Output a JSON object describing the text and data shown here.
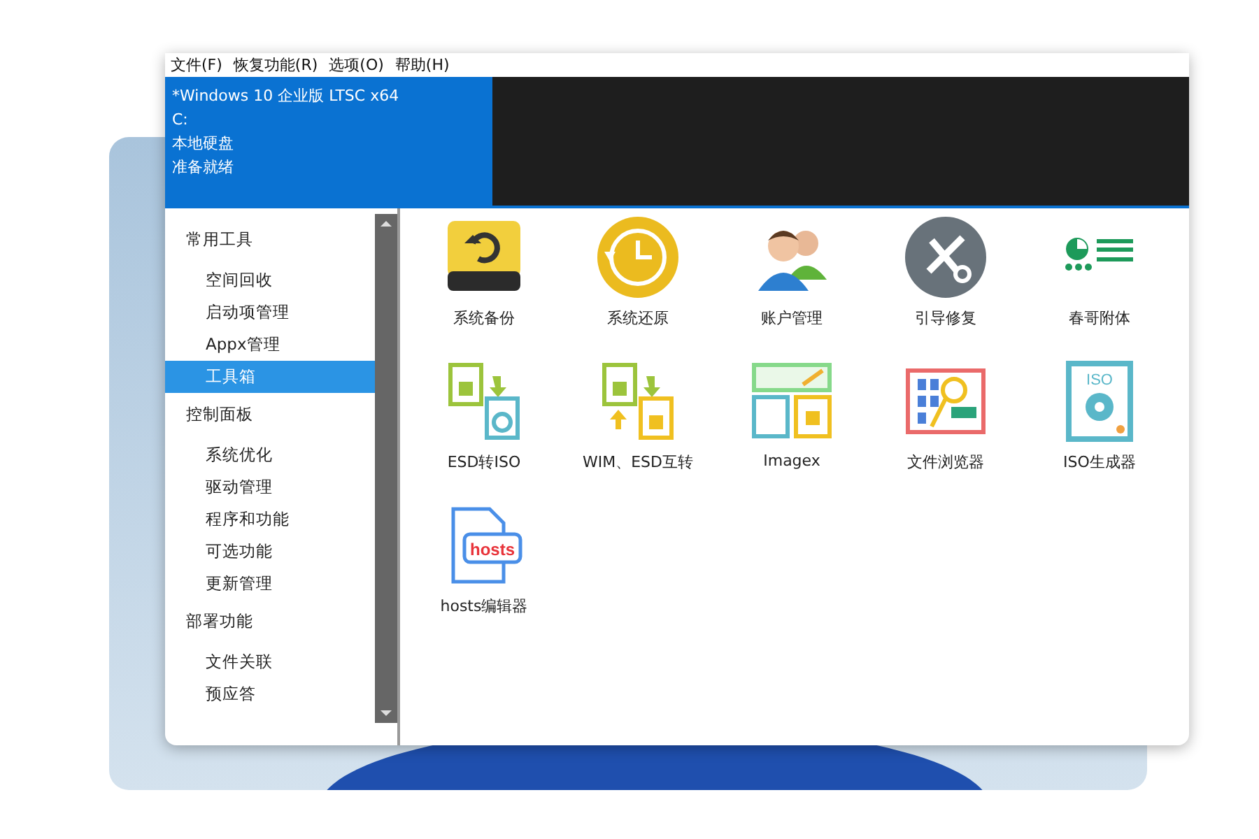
{
  "menu_bar": [
    "文件(F)",
    "恢复功能(R)",
    "选项(O)",
    "帮助(H)"
  ],
  "system_panel": {
    "lines": [
      "*Windows 10 企业版 LTSC x64",
      "C:",
      "本地硬盘",
      "准备就绪"
    ]
  },
  "sidebar": {
    "groups": [
      {
        "label": "常用工具",
        "items": [
          {
            "label": "空间回收",
            "selected": false
          },
          {
            "label": "启动项管理",
            "selected": false
          },
          {
            "label": "Appx管理",
            "selected": false
          },
          {
            "label": "工具箱",
            "selected": true
          }
        ]
      },
      {
        "label": "控制面板",
        "items": [
          {
            "label": "系统优化",
            "selected": false
          },
          {
            "label": "驱动管理",
            "selected": false
          },
          {
            "label": "程序和功能",
            "selected": false
          },
          {
            "label": "可选功能",
            "selected": false
          },
          {
            "label": "更新管理",
            "selected": false
          }
        ]
      },
      {
        "label": "部署功能",
        "items": [
          {
            "label": "文件关联",
            "selected": false
          },
          {
            "label": "预应答",
            "selected": false
          }
        ]
      }
    ]
  },
  "tools": [
    {
      "kind": "backup",
      "label": "系统备份"
    },
    {
      "kind": "restore",
      "label": "系统还原"
    },
    {
      "kind": "accounts",
      "label": "账户管理"
    },
    {
      "kind": "repair",
      "label": "引导修复"
    },
    {
      "kind": "addons",
      "label": "春哥附体"
    },
    {
      "kind": "esd2iso",
      "label": "ESD转ISO"
    },
    {
      "kind": "wimesd",
      "label": "WIM、ESD互转"
    },
    {
      "kind": "imagex",
      "label": "Imagex"
    },
    {
      "kind": "browser",
      "label": "文件浏览器"
    },
    {
      "kind": "iso",
      "label": "ISO生成器",
      "icon_text": "ISO"
    },
    {
      "kind": "hosts",
      "label": "hosts编辑器",
      "icon_text": "hosts"
    }
  ]
}
